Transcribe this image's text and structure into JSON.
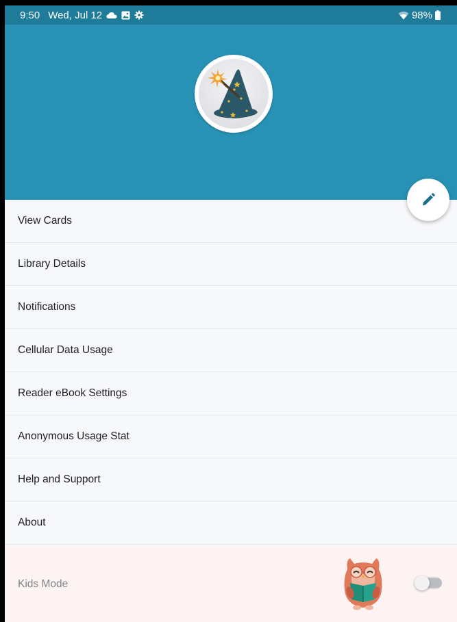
{
  "status_bar": {
    "time": "9:50",
    "date": "Wed, Jul 12",
    "battery": "98%",
    "icons": [
      "cloud-icon",
      "gallery-icon",
      "settings-icon",
      "wifi-icon",
      "battery-icon"
    ]
  },
  "profile": {
    "avatar": "wizard-hat-icon",
    "edit_icon": "pencil-icon"
  },
  "menu": {
    "items": [
      {
        "label": "View Cards"
      },
      {
        "label": "Library Details"
      },
      {
        "label": "Notifications"
      },
      {
        "label": "Cellular Data Usage"
      },
      {
        "label": "Reader eBook Settings"
      },
      {
        "label": "Anonymous Usage Stat"
      },
      {
        "label": "Help and Support"
      },
      {
        "label": "About"
      }
    ]
  },
  "kids_mode": {
    "label": "Kids Mode",
    "enabled": false,
    "mascot": "owl-reading-icon"
  },
  "colors": {
    "status_bar": "#1e7b9a",
    "header": "#2792b5",
    "accent": "#1a6e8c",
    "kids_background": "#fdf3f2"
  }
}
